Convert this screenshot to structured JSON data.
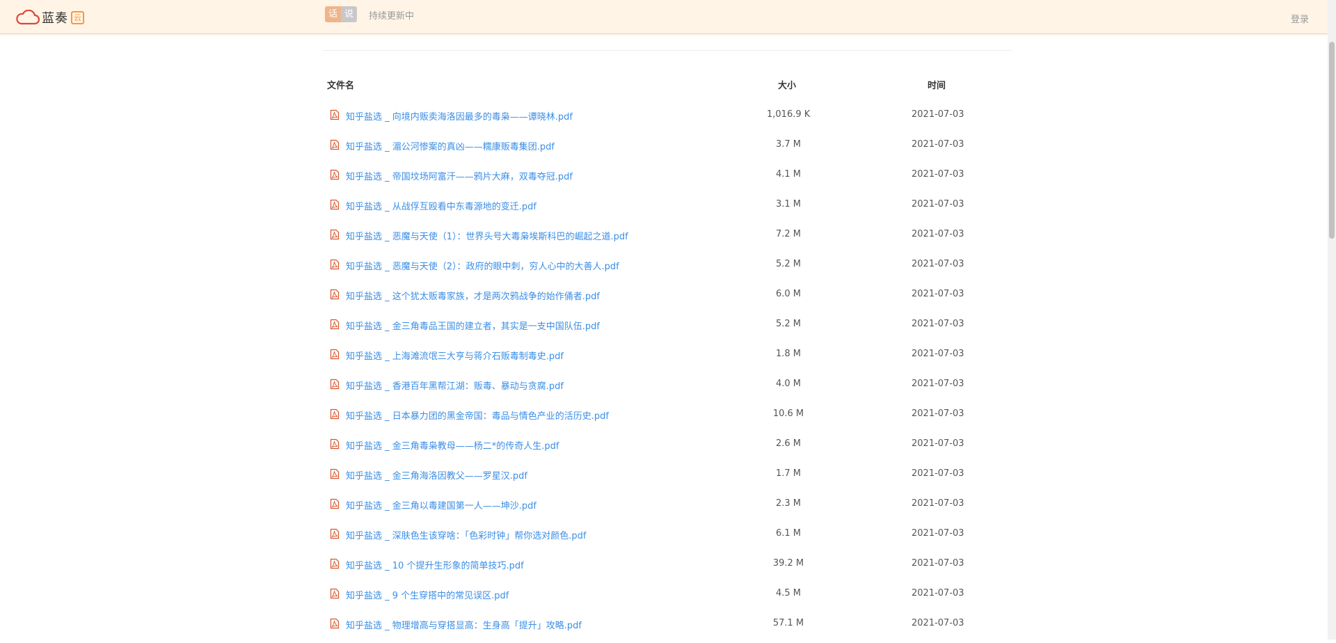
{
  "header": {
    "logo_text": "蓝奏",
    "logo_box_text": "云",
    "badge_left": "话",
    "badge_right": "说",
    "notice": "持续更新中",
    "login_label": "登录",
    "accent_color": "#f39a3a",
    "background_color": "#fff4e6"
  },
  "table": {
    "columns": {
      "name": "文件名",
      "size": "大小",
      "time": "时间"
    },
    "file_icon": "pdf-icon",
    "link_color": "#3a8ee6",
    "rows": [
      {
        "name": "知乎盐选 _ 向境内贩卖海洛因最多的毒枭——谭晓林.pdf",
        "size": "1,016.9 K",
        "time": "2021-07-03"
      },
      {
        "name": "知乎盐选 _ 湄公河惨案的真凶——糯康贩毒集团.pdf",
        "size": "3.7 M",
        "time": "2021-07-03"
      },
      {
        "name": "知乎盐选 _ 帝国坟场阿富汗——鸦片大麻，双毒夺冠.pdf",
        "size": "4.1 M",
        "time": "2021-07-03"
      },
      {
        "name": "知乎盐选 _ 从战俘互殴看中东毒源地的变迁.pdf",
        "size": "3.1 M",
        "time": "2021-07-03"
      },
      {
        "name": "知乎盐选 _ 恶魔与天使（1）：世界头号大毒枭埃斯科巴的崛起之道.pdf",
        "size": "7.2 M",
        "time": "2021-07-03"
      },
      {
        "name": "知乎盐选 _ 恶魔与天使（2）：政府的眼中刺，穷人心中的大善人.pdf",
        "size": "5.2 M",
        "time": "2021-07-03"
      },
      {
        "name": "知乎盐选 _ 这个犹太贩毒家族，才是两次鸦战争的始作俑者.pdf",
        "size": "6.0 M",
        "time": "2021-07-03"
      },
      {
        "name": "知乎盐选 _ 金三角毒品王国的建立者，其实是一支中国队伍.pdf",
        "size": "5.2 M",
        "time": "2021-07-03"
      },
      {
        "name": "知乎盐选 _ 上海滩流氓三大亨与蒋介石贩毒制毒史.pdf",
        "size": "1.8 M",
        "time": "2021-07-03"
      },
      {
        "name": "知乎盐选 _ 香港百年黑帮江湖：贩毒、暴动与贪腐.pdf",
        "size": "4.0 M",
        "time": "2021-07-03"
      },
      {
        "name": "知乎盐选 _ 日本暴力团的黑金帝国：毒品与情色产业的活历史.pdf",
        "size": "10.6 M",
        "time": "2021-07-03"
      },
      {
        "name": "知乎盐选 _ 金三角毒枭教母——杨二*的传奇人生.pdf",
        "size": "2.6 M",
        "time": "2021-07-03"
      },
      {
        "name": "知乎盐选 _ 金三角海洛因教父——罗星汉.pdf",
        "size": "1.7 M",
        "time": "2021-07-03"
      },
      {
        "name": "知乎盐选 _ 金三角以毒建国第一人——坤沙.pdf",
        "size": "2.3 M",
        "time": "2021-07-03"
      },
      {
        "name": "知乎盐选 _ 深肤色生该穿啥：「色彩时钟」帮你选对颜色.pdf",
        "size": "6.1 M",
        "time": "2021-07-03"
      },
      {
        "name": "知乎盐选 _ 10 个提升生形象的简单技巧.pdf",
        "size": "39.2 M",
        "time": "2021-07-03"
      },
      {
        "name": "知乎盐选 _ 9 个生穿搭中的常见误区.pdf",
        "size": "4.5 M",
        "time": "2021-07-03"
      },
      {
        "name": "知乎盐选 _ 物理增高与穿搭显高：生身高「提升」攻略.pdf",
        "size": "57.1 M",
        "time": "2021-07-03"
      }
    ]
  }
}
